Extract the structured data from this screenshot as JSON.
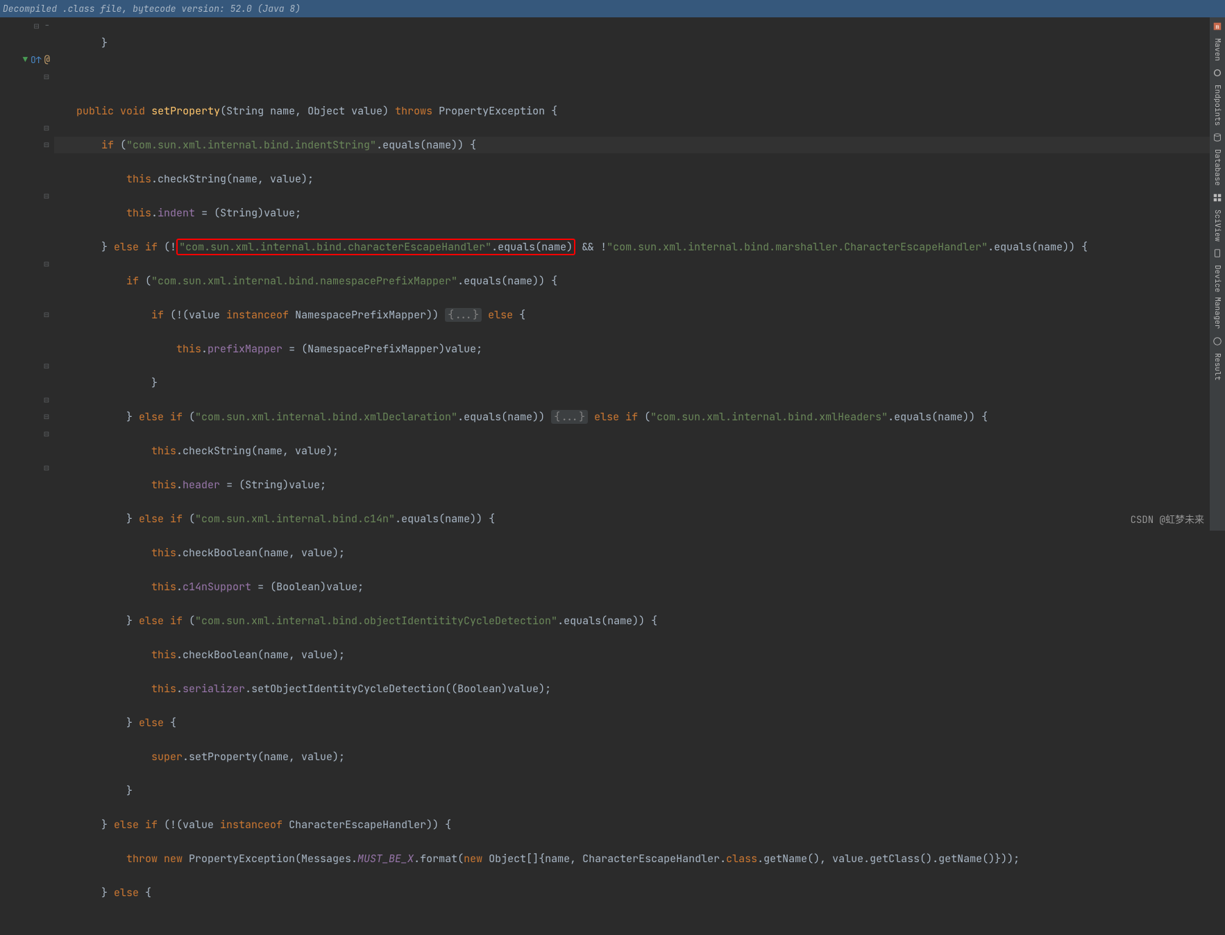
{
  "header": {
    "title": "Decompiled .class file, bytecode version: 52.0 (Java 8)"
  },
  "gutter": {
    "override_marker": "O↑",
    "at_marker": "@"
  },
  "code": {
    "l1": "    }",
    "l2": "",
    "sig_public": "public",
    "sig_void": "void",
    "sig_method": "setProperty",
    "sig_params": "(String name, Object value) ",
    "sig_throws": "throws",
    "sig_exc": " PropertyException {",
    "l4_if": "if",
    "l4_str": "\"com.sun.xml.internal.bind.indentString\"",
    "l4_rest": ".equals(name)) {",
    "l5_this": "this",
    "l5_rest": ".checkString(name, value);",
    "l6_this": "this",
    "l6_field": "indent",
    "l6_rest": " = (String)value;",
    "l7_else": "} ",
    "l7_elseif": "else if",
    "l7_open": " (!",
    "l7_boxed_str": "\"com.sun.xml.internal.bind.characterEscapeHandler\"",
    "l7_boxed_suffix": ".equals(name)",
    "l7_mid": " && !",
    "l7_str2": "\"com.sun.xml.internal.bind.marshaller.CharacterEscapeHandler\"",
    "l7_tail": ".equals(name)) {",
    "l8_if": "if",
    "l8_str": "\"com.sun.xml.internal.bind.namespacePrefixMapper\"",
    "l8_rest": ".equals(name)) {",
    "l9_if": "if",
    "l9_mid": " (!(value ",
    "l9_instanceof": "instanceof",
    "l9_type": " NamespacePrefixMapper)) ",
    "l9_fold": "{...}",
    "l9_else": " else",
    "l9_brace": " {",
    "l10_this": "this",
    "l10_field": "prefixMapper",
    "l10_rest": " = (NamespacePrefixMapper)value;",
    "l11": "            }",
    "l12_head": "        } ",
    "l12_elseif": "else if",
    "l12_open": " (",
    "l12_str": "\"com.sun.xml.internal.bind.xmlDeclaration\"",
    "l12_mid": ".equals(name)) ",
    "l12_fold": "{...}",
    "l12_elseif2": " else if",
    "l12_open2": " (",
    "l12_str2": "\"com.sun.xml.internal.bind.xmlHeaders\"",
    "l12_tail": ".equals(name)) {",
    "l13_this": "this",
    "l13_rest": ".checkString(name, value);",
    "l14_this": "this",
    "l14_field": "header",
    "l14_rest": " = (String)value;",
    "l15_head": "        } ",
    "l15_elseif": "else if",
    "l15_open": " (",
    "l15_str": "\"com.sun.xml.internal.bind.c14n\"",
    "l15_tail": ".equals(name)) {",
    "l16_this": "this",
    "l16_rest": ".checkBoolean(name, value);",
    "l17_this": "this",
    "l17_field": "c14nSupport",
    "l17_rest": " = (Boolean)value;",
    "l18_head": "        } ",
    "l18_elseif": "else if",
    "l18_open": " (",
    "l18_str": "\"com.sun.xml.internal.bind.objectIdentitityCycleDetection\"",
    "l18_tail": ".equals(name)) {",
    "l19_this": "this",
    "l19_rest": ".checkBoolean(name, value);",
    "l20_this": "this",
    "l20_field": "serializer",
    "l20_rest": ".setObjectIdentityCycleDetection((Boolean)value);",
    "l21_head": "        } ",
    "l21_else": "else",
    "l21_brace": " {",
    "l22_super": "super",
    "l22_rest": ".setProperty(name, value);",
    "l23": "        }",
    "l24_head": "    } ",
    "l24_elseif": "else if",
    "l24_open": " (!(value ",
    "l24_instanceof": "instanceof",
    "l24_rest": " CharacterEscapeHandler)) {",
    "l25_throw": "throw new",
    "l25_t1": " PropertyException(Messages.",
    "l25_mustbe": "MUST_BE_X",
    "l25_t2": ".format(",
    "l25_new": "new",
    "l25_t3": " Object[]{name, CharacterEscapeHandler.",
    "l25_class": "class",
    "l25_t4": ".getName(), value.getClass().getName()}));",
    "l26_head": "    } ",
    "l26_else": "else",
    "l26_brace": " {"
  },
  "side": {
    "maven": "Maven",
    "endpoints": "Endpoints",
    "database": "Database",
    "sciview": "SciView",
    "devmgr": "Device Manager",
    "result": "Result"
  },
  "watermark": "CSDN @虹梦未来"
}
